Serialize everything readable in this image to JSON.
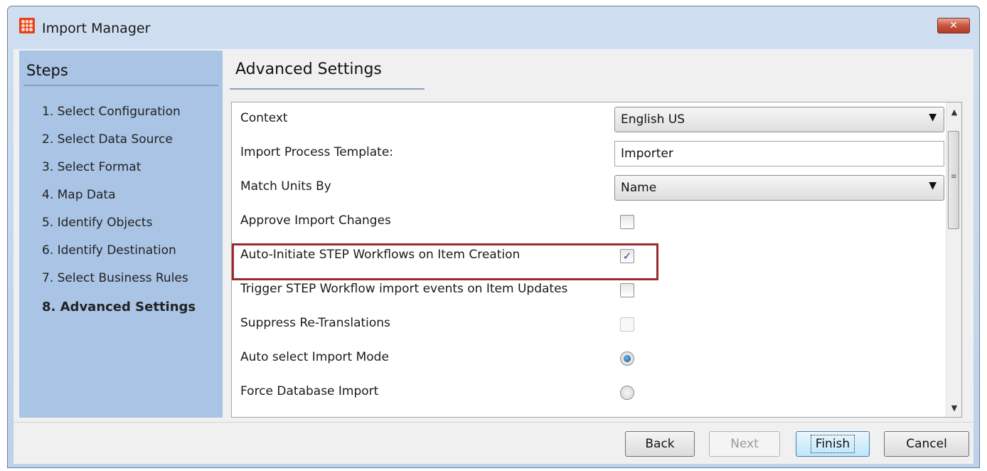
{
  "window": {
    "title": "Import Manager",
    "close_glyph": "✕"
  },
  "steps": {
    "header": "Steps",
    "items": [
      {
        "label": "1. Select Configuration"
      },
      {
        "label": "2. Select Data Source"
      },
      {
        "label": "3. Select Format"
      },
      {
        "label": "4. Map Data"
      },
      {
        "label": "5. Identify Objects"
      },
      {
        "label": "6. Identify Destination"
      },
      {
        "label": "7. Select Business Rules"
      },
      {
        "label": "8. Advanced Settings",
        "current": true
      }
    ]
  },
  "main": {
    "header": "Advanced Settings",
    "settings": {
      "context": {
        "label": "Context",
        "value": "English US"
      },
      "import_process_template": {
        "label": "Import Process Template:",
        "value": "Importer"
      },
      "match_units_by": {
        "label": "Match Units By",
        "value": "Name"
      },
      "approve_import_changes": {
        "label": "Approve Import Changes",
        "checked": false
      },
      "auto_initiate_workflows": {
        "label": "Auto-Initiate STEP Workflows on Item Creation",
        "checked": true
      },
      "trigger_workflow_events": {
        "label": "Trigger STEP Workflow import events on Item Updates",
        "checked": false
      },
      "suppress_retranslations": {
        "label": "Suppress Re-Translations",
        "checked": false,
        "disabled": true
      },
      "auto_select_import_mode": {
        "label": "Auto select Import Mode",
        "selected": true
      },
      "force_database_import": {
        "label": "Force Database Import",
        "selected": false
      }
    },
    "highlight_color": "#9b2a2e"
  },
  "buttons": {
    "back": "Back",
    "next": "Next",
    "finish": "Finish",
    "cancel": "Cancel"
  },
  "icons": {
    "dropdown": "▼",
    "check": "✓",
    "scroll_up": "▲",
    "scroll_down": "▼",
    "scroll_grip": "≡"
  },
  "colors": {
    "steps_panel": "#a9c4e4",
    "title_bar": "#cfdff0",
    "close_button": "#c8553f",
    "default_button": "#bee6fd"
  }
}
